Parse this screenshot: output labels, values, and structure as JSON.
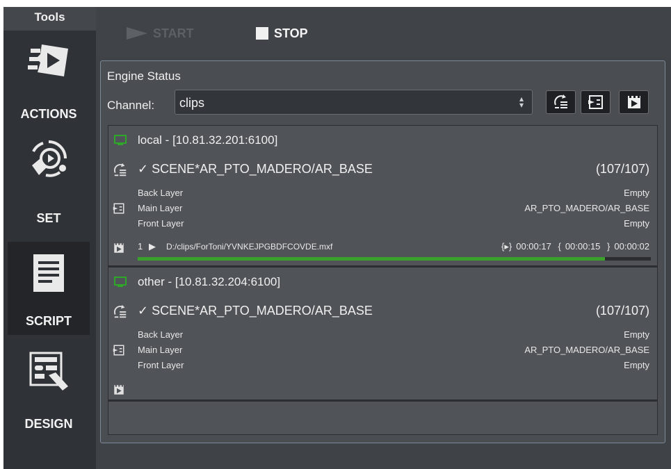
{
  "sidebar": {
    "title": "Tools",
    "items": [
      {
        "label": "ACTIONS",
        "icon": "actions-icon"
      },
      {
        "label": "SET",
        "icon": "set-icon"
      },
      {
        "label": "SCRIPT",
        "icon": "script-icon",
        "active": true
      },
      {
        "label": "DESIGN",
        "icon": "design-icon"
      }
    ]
  },
  "toolbar": {
    "start_label": "START",
    "stop_label": "STOP"
  },
  "panel": {
    "title": "Engine Status",
    "channel_label": "Channel:",
    "channel_value": "clips",
    "header_buttons": [
      "scene-status-icon",
      "layer-icon",
      "clip-icon"
    ]
  },
  "engines": [
    {
      "host": "local - [10.81.32.201:6100]",
      "scene": "✓ SCENE*AR_PTO_MADERO/AR_BASE",
      "count": "(107/107)",
      "layers": [
        {
          "label": "Back Layer",
          "value": "Empty"
        },
        {
          "label": "Main Layer",
          "value": "AR_PTO_MADERO/AR_BASE"
        },
        {
          "label": "Front Layer",
          "value": "Empty"
        }
      ],
      "clip": {
        "number": "1",
        "play_glyph": "▶",
        "path": "D:/clips/ForToni/YVNKEJPGBDFCOVDE.mxf",
        "duration": "00:00:17",
        "elapsed": "00:00:15",
        "remaining": "00:00:02",
        "progress": 0.91
      }
    },
    {
      "host": "other - [10.81.32.204:6100]",
      "scene": "✓ SCENE*AR_PTO_MADERO/AR_BASE",
      "count": "(107/107)",
      "layers": [
        {
          "label": "Back Layer",
          "value": "Empty"
        },
        {
          "label": "Main Layer",
          "value": "AR_PTO_MADERO/AR_BASE"
        },
        {
          "label": "Front Layer",
          "value": "Empty"
        }
      ]
    }
  ],
  "colors": {
    "accent_green": "#3aa12c",
    "host_green": "#2fa82a",
    "panel_border": "#7d8a99"
  }
}
